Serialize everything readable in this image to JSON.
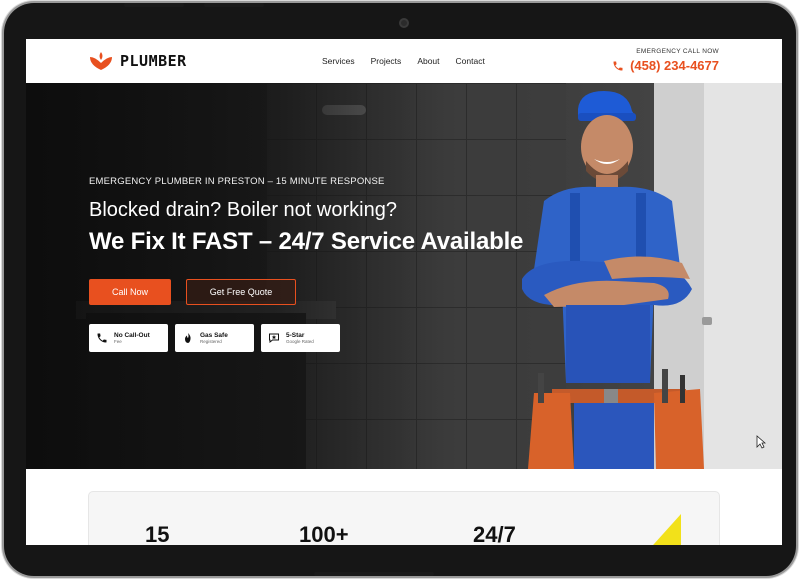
{
  "brand": {
    "name": "PLUMBER",
    "accent": "#e8501f"
  },
  "nav": {
    "items": [
      "Services",
      "Projects",
      "About",
      "Contact"
    ]
  },
  "contact": {
    "label": "EMERGENCY CALL NOW",
    "phone": "(458) 234-4677"
  },
  "hero": {
    "kicker": "EMERGENCY PLUMBER IN PRESTON – 15 MINUTE RESPONSE",
    "line1": "Blocked drain? Boiler not working?",
    "line2": "We Fix It FAST – 24/7 Service Available",
    "primary_cta": "Call Now",
    "secondary_cta": "Get Free Quote"
  },
  "badges": [
    {
      "title": "No Call-Out",
      "sub": "Fee",
      "icon": "phone-icon"
    },
    {
      "title": "Gas Safe",
      "sub": "Registered",
      "icon": "flame-icon"
    },
    {
      "title": "5-Star",
      "sub": "Google Rated",
      "icon": "review-icon"
    }
  ],
  "stats": [
    "15",
    "100+",
    "24/7"
  ]
}
